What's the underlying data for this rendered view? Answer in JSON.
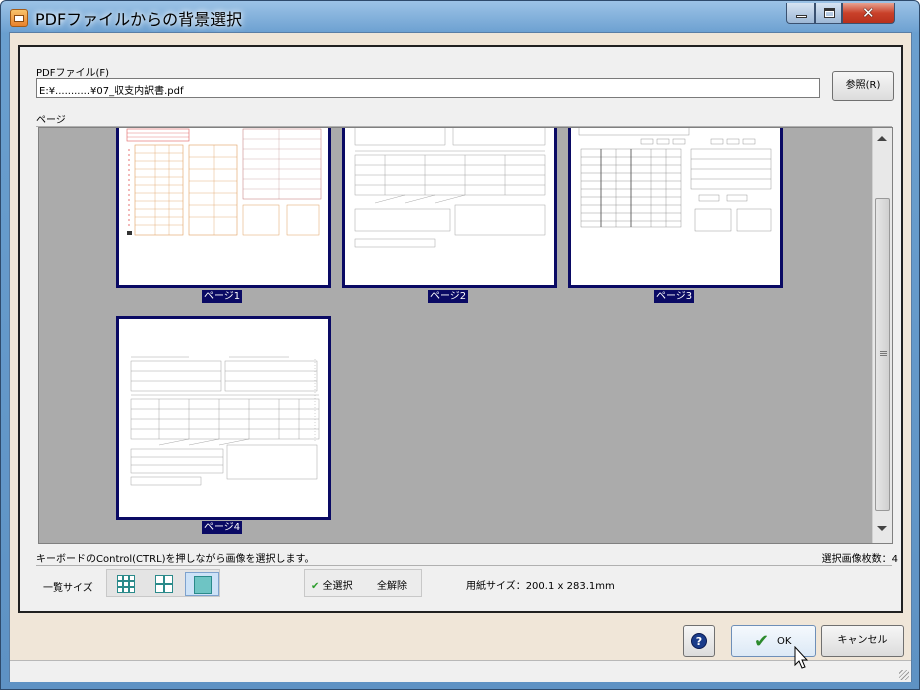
{
  "window": {
    "title": "PDFファイルからの背景選択"
  },
  "pdf_file": {
    "label": "PDFファイル(F)",
    "path": "E:¥...........¥07_収支内訳書.pdf",
    "browse_label": "参照(R)"
  },
  "pages": {
    "label": "ページ",
    "items": [
      {
        "label": "ページ1",
        "selected": true
      },
      {
        "label": "ページ2",
        "selected": true
      },
      {
        "label": "ページ3",
        "selected": true
      },
      {
        "label": "ページ4",
        "selected": true
      }
    ]
  },
  "status": {
    "hint": "キーボードのControl(CTRL)を押しながら画像を選択します。",
    "selected_count": "選択画像枚数：4"
  },
  "toolbar": {
    "list_size_label": "一覧サイズ",
    "select_all_label": "全選択",
    "deselect_all_label": "全解除",
    "paper_size": "用紙サイズ：200.1 x 283.1mm"
  },
  "footer": {
    "help_label": "?",
    "ok_label": "OK",
    "cancel_label": "キャンセル"
  },
  "colors": {
    "selection": "#0a0a64",
    "viewer_bg": "#ababab",
    "ok_check": "#2c8a2c"
  }
}
